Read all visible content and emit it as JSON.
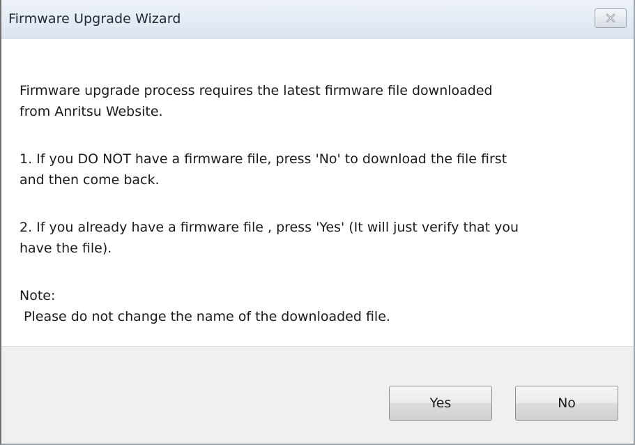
{
  "window": {
    "title": "Firmware Upgrade Wizard",
    "close_icon": "close-icon"
  },
  "message": {
    "paragraph_1": "Firmware upgrade process requires the latest firmware file downloaded\nfrom Anritsu Website.",
    "paragraph_2": "1. If you DO NOT have a firmware file, press 'No' to download the file first\nand then come back.",
    "paragraph_3": "2. If you already have a firmware file , press 'Yes' (It will just verify that you\nhave the file).",
    "paragraph_4": "Note:\n Please do not change the name of the downloaded file."
  },
  "buttons": {
    "yes_label": "Yes",
    "no_label": "No"
  }
}
